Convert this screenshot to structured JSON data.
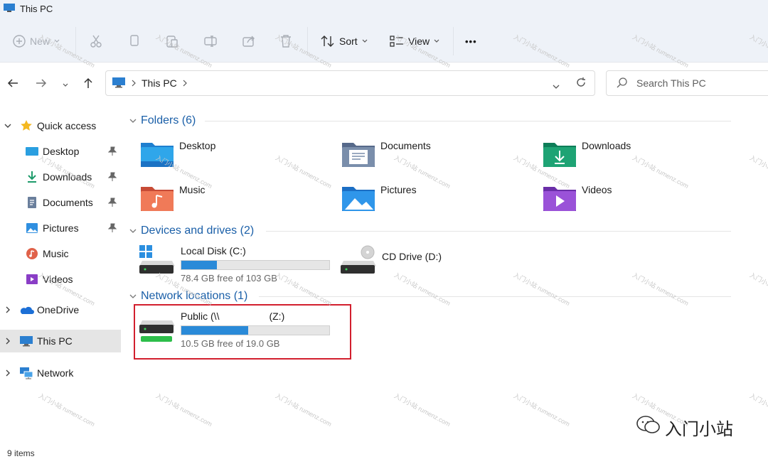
{
  "window": {
    "title": "This PC"
  },
  "toolbar": {
    "new_label": "New",
    "sort_label": "Sort",
    "view_label": "View",
    "more_label": "•••"
  },
  "address": {
    "crumbs": [
      "This PC"
    ],
    "search_placeholder": "Search This PC"
  },
  "sidebar": {
    "items": [
      {
        "label": "Quick access"
      },
      {
        "label": "Desktop"
      },
      {
        "label": "Downloads"
      },
      {
        "label": "Documents"
      },
      {
        "label": "Pictures"
      },
      {
        "label": "Music"
      },
      {
        "label": "Videos"
      },
      {
        "label": "OneDrive"
      },
      {
        "label": "This PC"
      },
      {
        "label": "Network"
      }
    ]
  },
  "groups": {
    "folders": {
      "label": "Folders (6)"
    },
    "devices": {
      "label": "Devices and drives (2)"
    },
    "network": {
      "label": "Network locations (1)"
    }
  },
  "folders": [
    {
      "label": "Desktop"
    },
    {
      "label": "Documents"
    },
    {
      "label": "Downloads"
    },
    {
      "label": "Music"
    },
    {
      "label": "Pictures"
    },
    {
      "label": "Videos"
    }
  ],
  "drives": [
    {
      "name": "Local Disk (C:)",
      "free": "78.4 GB free of 103 GB",
      "used_fraction": 0.24
    },
    {
      "name": "CD Drive (D:)"
    }
  ],
  "network_locations": [
    {
      "name": "Public (\\\\",
      "letter": "(Z:)",
      "free": "10.5 GB free of 19.0 GB",
      "used_fraction": 0.45
    }
  ],
  "status": {
    "items": "9 items"
  },
  "watermark": {
    "text": "入门小站 rumenz.com",
    "brand": "入门小站"
  },
  "colors": {
    "accent": "#1a5fa8",
    "bar": "#2a8ad8",
    "highlight": "#d21f2e"
  }
}
